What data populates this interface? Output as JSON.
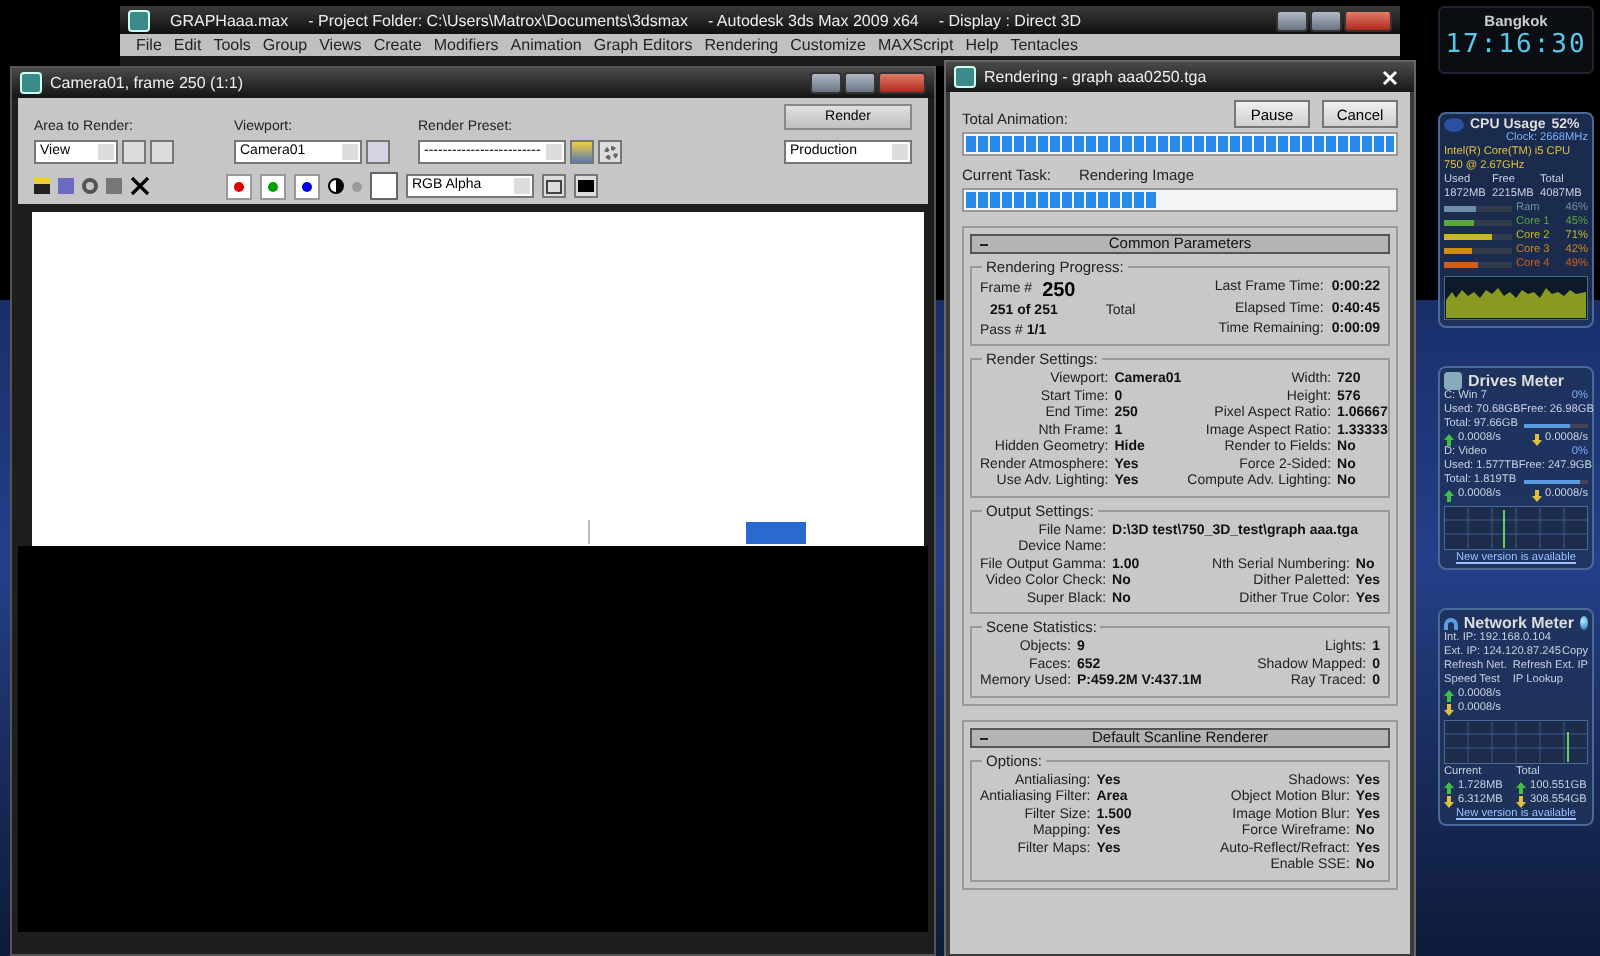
{
  "main_window": {
    "title_parts": [
      "GRAPHaaa.max",
      "- Project Folder: C:\\Users\\Matrox\\Documents\\3dsmax",
      "- Autodesk 3ds Max  2009 x64",
      "- Display : Direct 3D"
    ],
    "menu": [
      "File",
      "Edit",
      "Tools",
      "Group",
      "Views",
      "Create",
      "Modifiers",
      "Animation",
      "Graph Editors",
      "Rendering",
      "Customize",
      "MAXScript",
      "Help",
      "Tentacles"
    ]
  },
  "frame_window": {
    "title": "Camera01, frame 250 (1:1)",
    "area_to_render": {
      "label": "Area to Render:",
      "value": "View"
    },
    "viewport": {
      "label": "Viewport:",
      "value": "Camera01"
    },
    "render_preset": {
      "label": "Render Preset:",
      "value": "-------------------------"
    },
    "render_button": "Render",
    "mode": "Production",
    "channel": "RGB Alpha"
  },
  "rendering_dialog": {
    "title": "Rendering - graph aaa0250.tga",
    "buttons": [
      "Pause",
      "Cancel"
    ],
    "total_animation": {
      "label": "Total Animation:",
      "level": 1.0
    },
    "current_task": {
      "label": "Current Task:",
      "value": "Rendering Image",
      "level": 0.45
    },
    "common_parameters": {
      "title": "Common Parameters",
      "progress": {
        "title": "Rendering Progress:",
        "frame_label": "Frame #",
        "frame": "250",
        "count": "251  of  251",
        "total": "Total",
        "pass_label": "Pass #",
        "pass": "1/1",
        "times": [
          {
            "label": "Last Frame Time:",
            "value": "0:00:22"
          },
          {
            "label": "Elapsed Time:",
            "value": "0:40:45"
          },
          {
            "label": "Time Remaining:",
            "value": "0:00:09"
          }
        ]
      },
      "groups": [
        {
          "title": "Render Settings:",
          "rows": [
            {
              "left": {
                "label": "Viewport:",
                "value": "Camera01"
              },
              "right": {
                "label": "Width:",
                "value": "720"
              }
            },
            {
              "left": {
                "label": "Start Time:",
                "value": "0"
              },
              "right": {
                "label": "Height:",
                "value": "576"
              }
            },
            {
              "left": {
                "label": "End Time:",
                "value": "250"
              },
              "right": {
                "label": "Pixel Aspect Ratio:",
                "value": "1.06667"
              }
            },
            {
              "left": {
                "label": "Nth Frame:",
                "value": "1"
              },
              "right": {
                "label": "Image Aspect Ratio:",
                "value": "1.33333"
              }
            },
            {
              "left": {
                "label": "Hidden Geometry:",
                "value": "Hide"
              },
              "right": {
                "label": "Render to Fields:",
                "value": "No"
              }
            },
            {
              "left": {
                "label": "Render Atmosphere:",
                "value": "Yes"
              },
              "right": {
                "label": "Force 2-Sided:",
                "value": "No"
              }
            },
            {
              "left": {
                "label": "Use Adv. Lighting:",
                "value": "Yes"
              },
              "right": {
                "label": "Compute Adv. Lighting:",
                "value": "No"
              }
            }
          ]
        },
        {
          "title": "Output Settings:",
          "rows": [
            {
              "left": {
                "label": "File Name:",
                "value": "D:\\3D test\\750_3D_test\\graph aaa.tga"
              }
            },
            {
              "left": {
                "label": "Device Name:"
              }
            },
            {
              "left": {
                "label": "File Output Gamma:",
                "value": "1.00"
              },
              "right": {
                "label": "Nth Serial Numbering:",
                "value": "No"
              }
            },
            {
              "left": {
                "label": "Video Color Check:",
                "value": "No"
              },
              "right": {
                "label": "Dither Paletted:",
                "value": "Yes"
              }
            },
            {
              "left": {
                "label": "Super Black:",
                "value": "No"
              },
              "right": {
                "label": "Dither True Color:",
                "value": "Yes"
              }
            }
          ]
        },
        {
          "title": "Scene Statistics:",
          "rows": [
            {
              "left": {
                "label": "Objects:",
                "value": "9"
              },
              "right": {
                "label": "Lights:",
                "value": "1"
              }
            },
            {
              "left": {
                "label": "Faces:",
                "value": "652"
              },
              "right": {
                "label": "Shadow Mapped:",
                "value": "0"
              }
            },
            {
              "left": {
                "label": "Memory Used:",
                "value": "P:459.2M V:437.1M"
              },
              "right": {
                "label": "Ray Traced:",
                "value": "0"
              }
            }
          ]
        }
      ]
    },
    "scanline": {
      "title": "Default Scanline Renderer",
      "groups": [
        {
          "title": "Options:",
          "rows": [
            {
              "left": {
                "label": "Antialiasing:",
                "value": "Yes"
              },
              "right": {
                "label": "Shadows:",
                "value": "Yes"
              }
            },
            {
              "left": {
                "label": "Antialiasing Filter:",
                "value": "Area"
              },
              "right": {
                "label": "Object Motion Blur:",
                "value": "Yes"
              }
            },
            {
              "left": {
                "label": "Filter Size:",
                "value": "1.500"
              },
              "right": {
                "label": "Image Motion Blur:",
                "value": "Yes"
              }
            },
            {
              "left": {
                "label": "Mapping:",
                "value": "Yes"
              },
              "right": {
                "label": "Force Wireframe:",
                "value": "No"
              }
            },
            {
              "left": {
                "label": "Filter Maps:",
                "value": "Yes"
              },
              "right": {
                "label": "Auto-Reflect/Refract:",
                "value": "Yes"
              }
            },
            {
              "right": {
                "label": "Enable SSE:",
                "value": "No"
              }
            }
          ]
        }
      ]
    }
  },
  "clock": {
    "city": "Bangkok",
    "time": "17:16:30"
  },
  "cpu": {
    "title": "CPU Usage",
    "percent": "52%",
    "clock": "Clock: 2668MHz",
    "name": "Intel(R) Core(TM) i5 CPU 750 @ 2.67GHz",
    "mem_headers": [
      "Used",
      "Free",
      "Total"
    ],
    "mem_values": [
      "1872MB",
      "2215MB",
      "4087MB"
    ],
    "bars": [
      {
        "label": "Ram",
        "percent": "46%",
        "level": 0.46,
        "color": "#6f8fa8"
      },
      {
        "label": "Core 1",
        "percent": "45%",
        "level": 0.45,
        "color": "#5aa83c"
      },
      {
        "label": "Core 2",
        "percent": "71%",
        "level": 0.71,
        "color": "#c8b820"
      },
      {
        "label": "Core 3",
        "percent": "42%",
        "level": 0.42,
        "color": "#d08a18"
      },
      {
        "label": "Core 4",
        "percent": "49%",
        "level": 0.49,
        "color": "#d06018"
      }
    ]
  },
  "drives": {
    "title": "Drives Meter",
    "items": [
      {
        "name": "C: Win 7",
        "percent": "0%",
        "used": "Used: 70.68GB",
        "free": "Free: 26.98GB",
        "total": "Total: 97.66GB",
        "level": 0.72,
        "up": "0.0008/s",
        "down": "0.0008/s"
      },
      {
        "name": "D: Video",
        "percent": "0%",
        "used": "Used: 1.577TB",
        "free": "Free: 247.9GB",
        "total": "Total: 1.819TB",
        "level": 0.87,
        "up": "0.0008/s",
        "down": "0.0008/s"
      }
    ],
    "link": "New version is available"
  },
  "network": {
    "title": "Network Meter",
    "int_ip": "Int. IP: 192.168.0.104",
    "ext_ip": "Ext. IP: 124.120.87.245",
    "copy": "Copy",
    "links": [
      "Refresh Net.",
      "Refresh Ext. IP",
      "Speed Test",
      "IP Lookup"
    ],
    "up": "0.0008/s",
    "down": "0.0008/s",
    "current": "Current",
    "total": "Total",
    "current_up": "1.728MB",
    "total_up": "100.551GB",
    "current_down": "6.312MB",
    "total_down": "308.554GB",
    "link": "New version is available"
  }
}
